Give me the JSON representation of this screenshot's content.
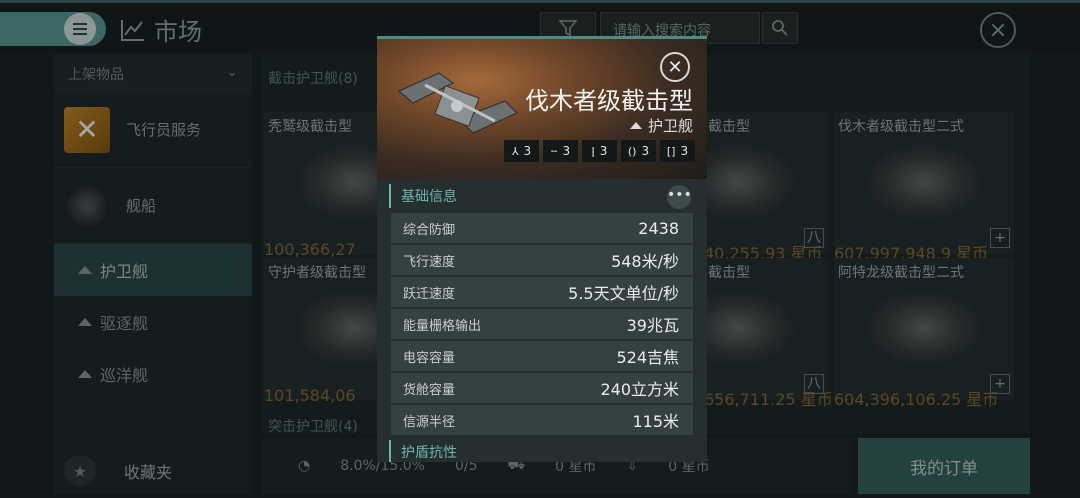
{
  "topbar": {
    "title": "市场",
    "search_placeholder": "请输入搜索内容"
  },
  "sidebar": {
    "header": "上架物品",
    "items": [
      {
        "label": "飞行员服务"
      },
      {
        "label": "舰船"
      }
    ],
    "subitems": [
      {
        "label": "护卫舰"
      },
      {
        "label": "驱逐舰"
      },
      {
        "label": "巡洋舰"
      }
    ],
    "favorites": "收藏夹"
  },
  "grid": {
    "section_title": "截击护卫舰(8)",
    "section_footer": "突击护卫舰(4)",
    "cards": [
      {
        "name": "秃鹫级截击型",
        "price": "100,366,27"
      },
      {
        "name": "截击型",
        "price": "40,255.93 星币"
      },
      {
        "name": "伐木者级截击型二式",
        "price": "607,997,948.9 星币"
      },
      {
        "name": "守护者级截击型",
        "price": "101,584,06"
      },
      {
        "name": "截击型",
        "price": "656,711.25 星币"
      },
      {
        "name": "阿特龙级截击型二式",
        "price": "604,396,106.25 星币"
      }
    ]
  },
  "bottombar": {
    "tax": "8.0%/15.0%",
    "count": "0/5",
    "sell_value": "0 星币",
    "buy_value": "0 星币",
    "orders_label": "我的订单"
  },
  "modal": {
    "ship_name": "伐木者级截击型",
    "ship_class": "护卫舰",
    "slots": [
      {
        "icon": "turret-icon",
        "glyph": "⅄",
        "count": "3"
      },
      {
        "icon": "launcher-icon",
        "glyph": "╌",
        "count": "3"
      },
      {
        "icon": "high-slot-icon",
        "glyph": "ǀ",
        "count": "3"
      },
      {
        "icon": "mid-slot-icon",
        "glyph": "()",
        "count": "3"
      },
      {
        "icon": "low-slot-icon",
        "glyph": "[]",
        "count": "3"
      }
    ],
    "section_basic": "基础信息",
    "section_shield": "护盾抗性",
    "more_glyph": "•••",
    "stats": [
      {
        "key": "综合防御",
        "value": "2438"
      },
      {
        "key": "飞行速度",
        "value": "548米/秒"
      },
      {
        "key": "跃迁速度",
        "value": "5.5天文单位/秒"
      },
      {
        "key": "能量栅格输出",
        "value": "39兆瓦"
      },
      {
        "key": "电容容量",
        "value": "524吉焦"
      },
      {
        "key": "货舱容量",
        "value": "240立方米"
      },
      {
        "key": "信源半径",
        "value": "115米"
      }
    ]
  }
}
